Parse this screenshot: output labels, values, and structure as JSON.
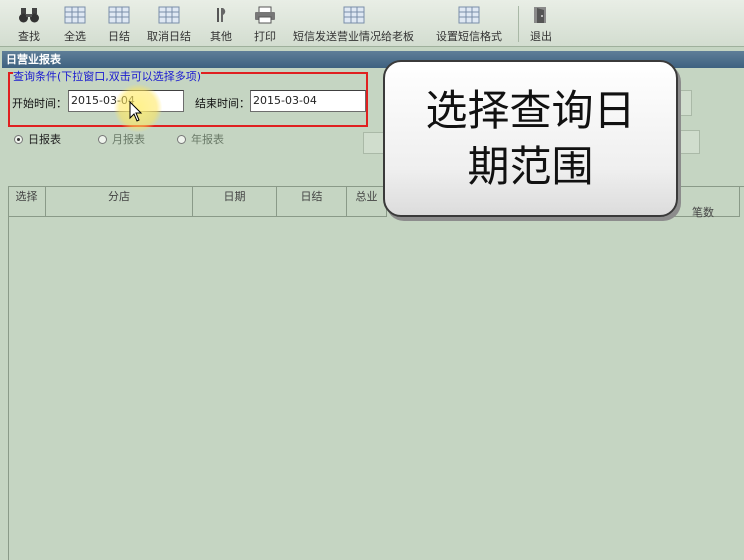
{
  "toolbar": {
    "items": [
      {
        "label": "查找",
        "icon": "binoculars-icon"
      },
      {
        "label": "全选",
        "icon": "grid-icon"
      },
      {
        "label": "日结",
        "icon": "grid-icon"
      },
      {
        "label": "取消日结",
        "icon": "grid-icon"
      },
      {
        "label": "其他",
        "icon": "tools-icon"
      },
      {
        "label": "打印",
        "icon": "printer-icon"
      },
      {
        "label": "短信发送营业情况给老板",
        "icon": "grid-icon"
      },
      {
        "label": "设置短信格式",
        "icon": "grid-icon"
      },
      {
        "label": "退出",
        "icon": "exit-door-icon"
      }
    ]
  },
  "panel": {
    "title": "日营业报表"
  },
  "query": {
    "caption": "查询条件(下拉窗口,双击可以选择多项)",
    "start_label": "开始时间：",
    "start_value": "2015-03-04",
    "end_label": "结束时间：",
    "end_value": "2015-03-04"
  },
  "report_types": [
    {
      "label": "日报表",
      "selected": true
    },
    {
      "label": "月报表",
      "selected": false
    },
    {
      "label": "年报表",
      "selected": false
    }
  ],
  "grid": {
    "columns": [
      "选择",
      "分店",
      "日期",
      "日结",
      "总业",
      "笔数"
    ]
  },
  "callout": {
    "line1": "选择查询日",
    "line2": "期范围"
  },
  "colors": {
    "background": "#c5d5c2",
    "panel_title": "#3e6180",
    "highlight_border": "#e02020",
    "caption_text": "#1a1ad0"
  }
}
